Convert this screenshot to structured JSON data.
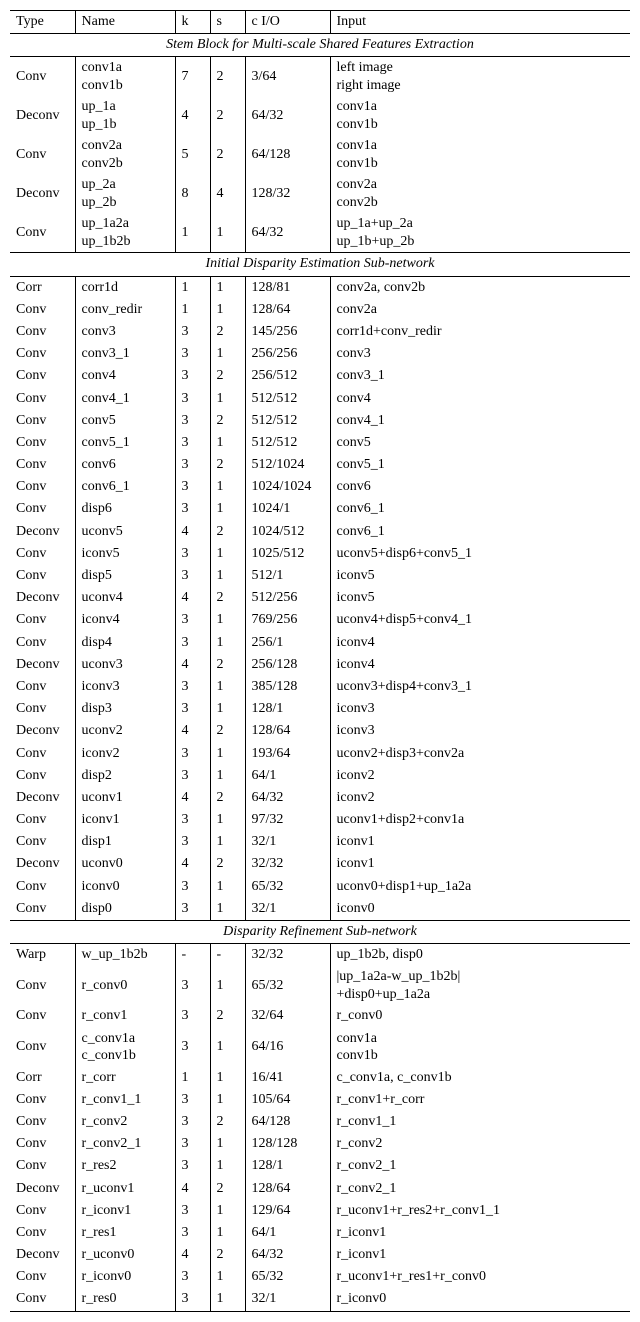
{
  "headers": {
    "type": "Type",
    "name": "Name",
    "k": "k",
    "s": "s",
    "cio": "c I/O",
    "input": "Input"
  },
  "sections": [
    {
      "title": "Stem Block for Multi-scale Shared Features Extraction",
      "rows": [
        {
          "type": "Conv",
          "name": "conv1a\nconv1b",
          "k": "7",
          "s": "2",
          "cio": "3/64",
          "input": "left image\nright image"
        },
        {
          "type": "Deconv",
          "name": "up_1a\nup_1b",
          "k": "4",
          "s": "2",
          "cio": "64/32",
          "input": "conv1a\nconv1b"
        },
        {
          "type": "Conv",
          "name": "conv2a\nconv2b",
          "k": "5",
          "s": "2",
          "cio": "64/128",
          "input": "conv1a\nconv1b"
        },
        {
          "type": "Deconv",
          "name": "up_2a\nup_2b",
          "k": "8",
          "s": "4",
          "cio": "128/32",
          "input": "conv2a\nconv2b"
        },
        {
          "type": "Conv",
          "name": "up_1a2a\nup_1b2b",
          "k": "1",
          "s": "1",
          "cio": "64/32",
          "input": "up_1a+up_2a\nup_1b+up_2b"
        }
      ]
    },
    {
      "title": "Initial Disparity Estimation Sub-network",
      "rows": [
        {
          "type": "Corr",
          "name": "corr1d",
          "k": "1",
          "s": "1",
          "cio": "128/81",
          "input": "conv2a, conv2b"
        },
        {
          "type": "Conv",
          "name": "conv_redir",
          "k": "1",
          "s": "1",
          "cio": "128/64",
          "input": "conv2a"
        },
        {
          "type": "Conv",
          "name": "conv3",
          "k": "3",
          "s": "2",
          "cio": "145/256",
          "input": "corr1d+conv_redir"
        },
        {
          "type": "Conv",
          "name": "conv3_1",
          "k": "3",
          "s": "1",
          "cio": "256/256",
          "input": "conv3"
        },
        {
          "type": "Conv",
          "name": "conv4",
          "k": "3",
          "s": "2",
          "cio": "256/512",
          "input": "conv3_1"
        },
        {
          "type": "Conv",
          "name": "conv4_1",
          "k": "3",
          "s": "1",
          "cio": "512/512",
          "input": "conv4"
        },
        {
          "type": "Conv",
          "name": "conv5",
          "k": "3",
          "s": "2",
          "cio": "512/512",
          "input": "conv4_1"
        },
        {
          "type": "Conv",
          "name": "conv5_1",
          "k": "3",
          "s": "1",
          "cio": "512/512",
          "input": "conv5"
        },
        {
          "type": "Conv",
          "name": "conv6",
          "k": "3",
          "s": "2",
          "cio": "512/1024",
          "input": "conv5_1"
        },
        {
          "type": "Conv",
          "name": "conv6_1",
          "k": "3",
          "s": "1",
          "cio": "1024/1024",
          "input": "conv6"
        },
        {
          "type": "Conv",
          "name": "disp6",
          "k": "3",
          "s": "1",
          "cio": "1024/1",
          "input": "conv6_1"
        },
        {
          "type": "Deconv",
          "name": "uconv5",
          "k": "4",
          "s": "2",
          "cio": "1024/512",
          "input": "conv6_1"
        },
        {
          "type": "Conv",
          "name": "iconv5",
          "k": "3",
          "s": "1",
          "cio": "1025/512",
          "input": "uconv5+disp6+conv5_1"
        },
        {
          "type": "Conv",
          "name": "disp5",
          "k": "3",
          "s": "1",
          "cio": "512/1",
          "input": "iconv5"
        },
        {
          "type": "Deconv",
          "name": "uconv4",
          "k": "4",
          "s": "2",
          "cio": "512/256",
          "input": "iconv5"
        },
        {
          "type": "Conv",
          "name": "iconv4",
          "k": "3",
          "s": "1",
          "cio": "769/256",
          "input": "uconv4+disp5+conv4_1"
        },
        {
          "type": "Conv",
          "name": "disp4",
          "k": "3",
          "s": "1",
          "cio": "256/1",
          "input": "iconv4"
        },
        {
          "type": "Deconv",
          "name": "uconv3",
          "k": "4",
          "s": "2",
          "cio": "256/128",
          "input": "iconv4"
        },
        {
          "type": "Conv",
          "name": "iconv3",
          "k": "3",
          "s": "1",
          "cio": "385/128",
          "input": "uconv3+disp4+conv3_1"
        },
        {
          "type": "Conv",
          "name": "disp3",
          "k": "3",
          "s": "1",
          "cio": "128/1",
          "input": "iconv3"
        },
        {
          "type": "Deconv",
          "name": "uconv2",
          "k": "4",
          "s": "2",
          "cio": "128/64",
          "input": "iconv3"
        },
        {
          "type": "Conv",
          "name": "iconv2",
          "k": "3",
          "s": "1",
          "cio": "193/64",
          "input": "uconv2+disp3+conv2a"
        },
        {
          "type": "Conv",
          "name": "disp2",
          "k": "3",
          "s": "1",
          "cio": "64/1",
          "input": "iconv2"
        },
        {
          "type": "Deconv",
          "name": "uconv1",
          "k": "4",
          "s": "2",
          "cio": "64/32",
          "input": "iconv2"
        },
        {
          "type": "Conv",
          "name": "iconv1",
          "k": "3",
          "s": "1",
          "cio": "97/32",
          "input": "uconv1+disp2+conv1a"
        },
        {
          "type": "Conv",
          "name": "disp1",
          "k": "3",
          "s": "1",
          "cio": "32/1",
          "input": "iconv1"
        },
        {
          "type": "Deconv",
          "name": "uconv0",
          "k": "4",
          "s": "2",
          "cio": "32/32",
          "input": "iconv1"
        },
        {
          "type": "Conv",
          "name": "iconv0",
          "k": "3",
          "s": "1",
          "cio": "65/32",
          "input": "uconv0+disp1+up_1a2a"
        },
        {
          "type": "Conv",
          "name": "disp0",
          "k": "3",
          "s": "1",
          "cio": "32/1",
          "input": "iconv0"
        }
      ]
    },
    {
      "title": "Disparity Refinement Sub-network",
      "rows": [
        {
          "type": "Warp",
          "name": "w_up_1b2b",
          "k": "-",
          "s": "-",
          "cio": "32/32",
          "input": "up_1b2b, disp0"
        },
        {
          "type": "Conv",
          "name": "r_conv0",
          "k": "3",
          "s": "1",
          "cio": "65/32",
          "input": "|up_1a2a-w_up_1b2b|\n+disp0+up_1a2a"
        },
        {
          "type": "Conv",
          "name": "r_conv1",
          "k": "3",
          "s": "2",
          "cio": "32/64",
          "input": "r_conv0"
        },
        {
          "type": "Conv",
          "name": "c_conv1a\nc_conv1b",
          "k": "3",
          "s": "1",
          "cio": "64/16",
          "input": "conv1a\nconv1b"
        },
        {
          "type": "Corr",
          "name": "r_corr",
          "k": "1",
          "s": "1",
          "cio": "16/41",
          "input": "c_conv1a, c_conv1b"
        },
        {
          "type": "Conv",
          "name": "r_conv1_1",
          "k": "3",
          "s": "1",
          "cio": "105/64",
          "input": "r_conv1+r_corr"
        },
        {
          "type": "Conv",
          "name": "r_conv2",
          "k": "3",
          "s": "2",
          "cio": "64/128",
          "input": "r_conv1_1"
        },
        {
          "type": "Conv",
          "name": "r_conv2_1",
          "k": "3",
          "s": "1",
          "cio": "128/128",
          "input": "r_conv2"
        },
        {
          "type": "Conv",
          "name": "r_res2",
          "k": "3",
          "s": "1",
          "cio": "128/1",
          "input": "r_conv2_1"
        },
        {
          "type": "Deconv",
          "name": "r_uconv1",
          "k": "4",
          "s": "2",
          "cio": "128/64",
          "input": "r_conv2_1"
        },
        {
          "type": "Conv",
          "name": "r_iconv1",
          "k": "3",
          "s": "1",
          "cio": "129/64",
          "input": "r_uconv1+r_res2+r_conv1_1"
        },
        {
          "type": "Conv",
          "name": "r_res1",
          "k": "3",
          "s": "1",
          "cio": "64/1",
          "input": "r_iconv1"
        },
        {
          "type": "Deconv",
          "name": "r_uconv0",
          "k": "4",
          "s": "2",
          "cio": "64/32",
          "input": "r_iconv1"
        },
        {
          "type": "Conv",
          "name": "r_iconv0",
          "k": "3",
          "s": "1",
          "cio": "65/32",
          "input": "r_uconv1+r_res1+r_conv0"
        },
        {
          "type": "Conv",
          "name": "r_res0",
          "k": "3",
          "s": "1",
          "cio": "32/1",
          "input": "r_iconv0"
        }
      ]
    }
  ]
}
